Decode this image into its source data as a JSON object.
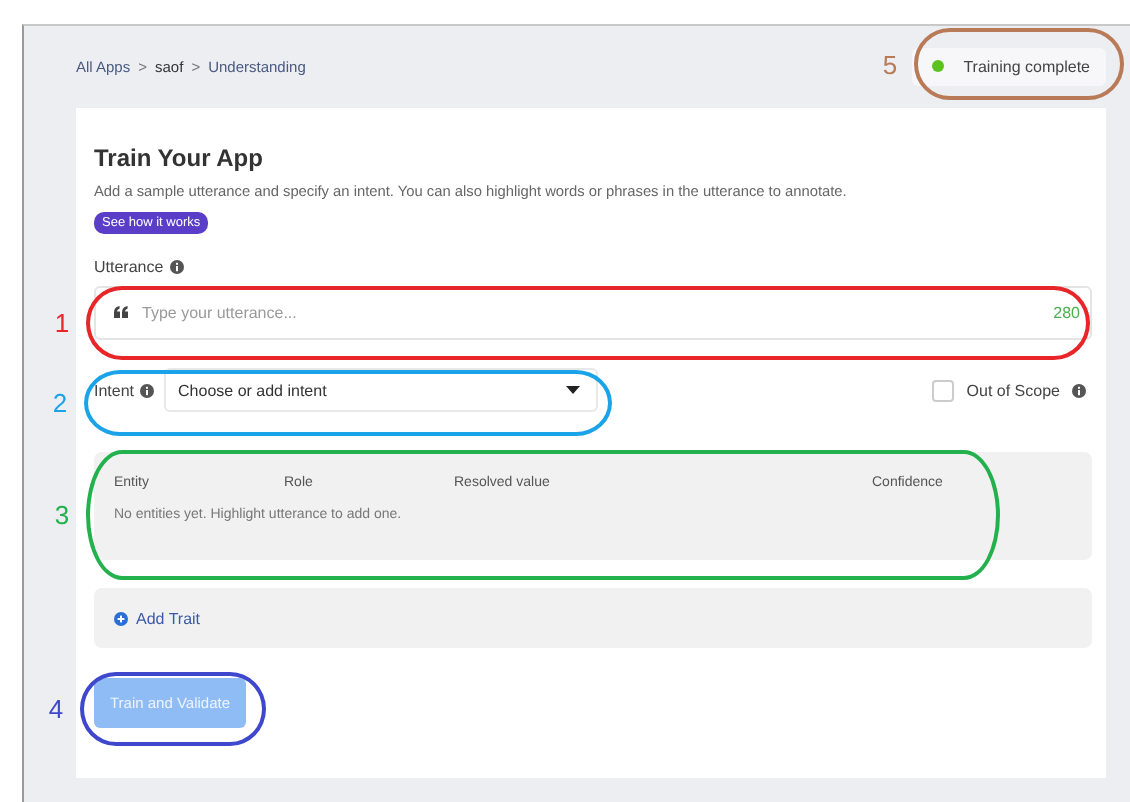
{
  "breadcrumb": [
    {
      "label": "All Apps",
      "kind": "link"
    },
    {
      "label": ">",
      "kind": "separator"
    },
    {
      "label": "saof",
      "kind": "current"
    },
    {
      "label": ">",
      "kind": "separator"
    },
    {
      "label": "Understanding",
      "kind": "link"
    }
  ],
  "status": {
    "label": "Training complete"
  },
  "card": {
    "title": "Train Your App",
    "description": "Add a sample utterance and specify an intent. You can also highlight words or phrases in the utterance to annotate.",
    "help_button": "See how it works",
    "utterance": {
      "label": "Utterance",
      "placeholder": "Type your utterance...",
      "counter": "280"
    },
    "intent": {
      "label": "Intent",
      "placeholder": "Choose or add intent"
    },
    "out_of_scope": {
      "label": "Out of Scope",
      "checked": false
    },
    "entities": {
      "columns": [
        "Entity",
        "Role",
        "Resolved value",
        "Confidence"
      ],
      "empty_text": "No entities yet. Highlight utterance to add one."
    },
    "add_trait": "Add Trait",
    "train_button": {
      "label": "Train and Validate",
      "disabled": true
    }
  },
  "annotations": [
    {
      "number": "1",
      "color": "#e8262a"
    },
    {
      "number": "2",
      "color": "#1aa3e8"
    },
    {
      "number": "3",
      "color": "#22b14c"
    },
    {
      "number": "4",
      "color": "#3f48cc"
    },
    {
      "number": "5",
      "color": "#b97a57"
    }
  ]
}
